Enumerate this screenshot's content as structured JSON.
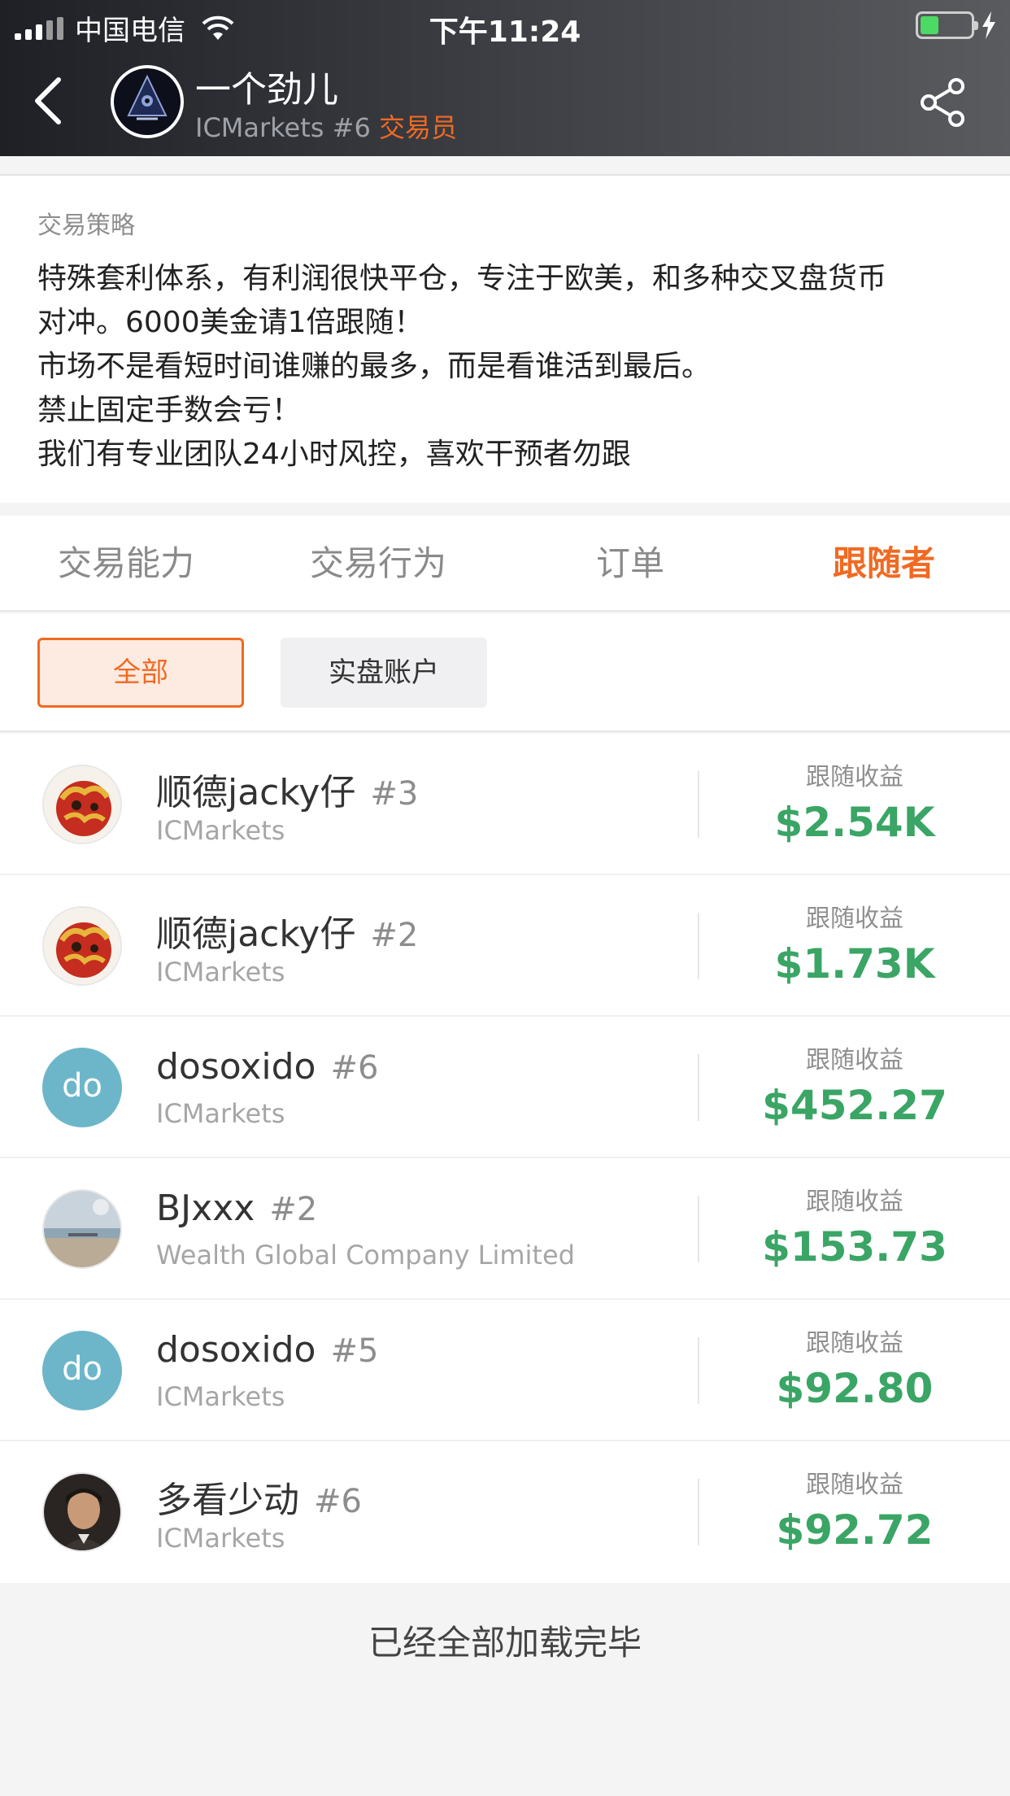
{
  "status_bar": {
    "carrier": "中国电信",
    "time": "下午11:24"
  },
  "header": {
    "trader_name": "一个劲儿",
    "trader_broker": "ICMarkets #6",
    "trader_role": "交易员"
  },
  "strategy": {
    "label": "交易策略",
    "lines": [
      "特殊套利体系，有利润很快平仓，专注于欧美，和多种交叉盘货币",
      "对冲。6000美金请1倍跟随！",
      "市场不是看短时间谁赚的最多，而是看谁活到最后。",
      "禁止固定手数会亏！",
      "我们有专业团队24小时风控，喜欢干预者勿跟"
    ]
  },
  "tabs": [
    {
      "label": "交易能力"
    },
    {
      "label": "交易行为"
    },
    {
      "label": "订单"
    },
    {
      "label": "跟随者",
      "active": true
    }
  ],
  "filters": {
    "all": "全部",
    "live": "实盘账户"
  },
  "followers": [
    {
      "name": "顺德jacky仔",
      "num": "#3",
      "broker": "ICMarkets",
      "earn_label": "跟随收益",
      "earn": "$2.54K",
      "avatar": "dragon"
    },
    {
      "name": "顺德jacky仔",
      "num": "#2",
      "broker": "ICMarkets",
      "earn_label": "跟随收益",
      "earn": "$1.73K",
      "avatar": "dragon"
    },
    {
      "name": "dosoxido",
      "num": "#6",
      "broker": "ICMarkets",
      "earn_label": "跟随收益",
      "earn": "$452.27",
      "avatar": "letter",
      "initials": "do"
    },
    {
      "name": "BJxxx",
      "num": "#2",
      "broker": "Wealth Global Company Limited",
      "earn_label": "跟随收益",
      "earn": "$153.73",
      "avatar": "beach"
    },
    {
      "name": "dosoxido",
      "num": "#5",
      "broker": "ICMarkets",
      "earn_label": "跟随收益",
      "earn": "$92.80",
      "avatar": "letter",
      "initials": "do"
    },
    {
      "name": "多看少动",
      "num": "#6",
      "broker": "ICMarkets",
      "earn_label": "跟随收益",
      "earn": "$92.72",
      "avatar": "portrait"
    }
  ],
  "footer": {
    "text": "已经全部加载完毕"
  },
  "colors": {
    "accent": "#f06a22",
    "earn_green": "#3aa565",
    "avatar_letter_bg": "#6db6c9"
  }
}
